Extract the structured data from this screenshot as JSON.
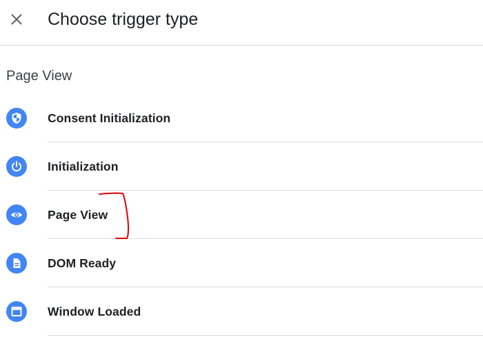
{
  "header": {
    "title": "Choose trigger type"
  },
  "section": {
    "title": "Page View"
  },
  "triggers": [
    {
      "label": "Consent Initialization",
      "icon": "shield-icon"
    },
    {
      "label": "Initialization",
      "icon": "power-icon"
    },
    {
      "label": "Page View",
      "icon": "eye-icon"
    },
    {
      "label": "DOM Ready",
      "icon": "document-icon"
    },
    {
      "label": "Window Loaded",
      "icon": "window-icon"
    }
  ],
  "colors": {
    "icon_bg": "#4285f4",
    "annotation": "#e00000",
    "divider": "#dadce0"
  }
}
